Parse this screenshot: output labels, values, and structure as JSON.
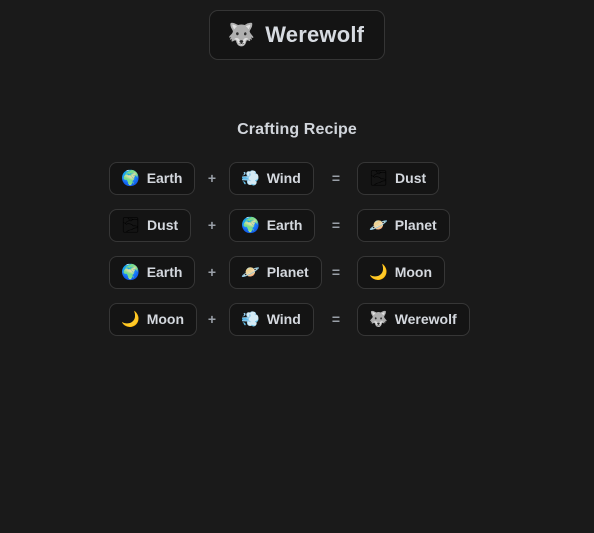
{
  "page": {
    "background_color": "#1a1a1a",
    "chip_background_color": "#141414",
    "chip_border_color": "#363636",
    "text_color": "#d4d8de"
  },
  "header": {
    "icon": "wolf-icon",
    "icon_glyph": "🐺",
    "title": "Werewolf"
  },
  "section": {
    "heading": "Crafting Recipe"
  },
  "operators": {
    "plus": "+",
    "equals": "="
  },
  "recipes": [
    {
      "input_a": {
        "icon": "earth-icon",
        "icon_glyph": "🌍",
        "label": "Earth"
      },
      "operator": "+",
      "input_b": {
        "icon": "wind-icon",
        "icon_glyph": "💨",
        "label": "Wind"
      },
      "equals": "=",
      "result": {
        "icon": "fog-icon",
        "icon_glyph": "🌫",
        "label": "Dust"
      }
    },
    {
      "input_a": {
        "icon": "fog-icon",
        "icon_glyph": "🌫",
        "label": "Dust"
      },
      "operator": "+",
      "input_b": {
        "icon": "earth-icon",
        "icon_glyph": "🌍",
        "label": "Earth"
      },
      "equals": "=",
      "result": {
        "icon": "planet-icon",
        "icon_glyph": "🪐",
        "label": "Planet"
      }
    },
    {
      "input_a": {
        "icon": "earth-icon",
        "icon_glyph": "🌍",
        "label": "Earth"
      },
      "operator": "+",
      "input_b": {
        "icon": "planet-icon",
        "icon_glyph": "🪐",
        "label": "Planet"
      },
      "equals": "=",
      "result": {
        "icon": "moon-icon",
        "icon_glyph": "🌙",
        "label": "Moon"
      }
    },
    {
      "input_a": {
        "icon": "moon-icon",
        "icon_glyph": "🌙",
        "label": "Moon"
      },
      "operator": "+",
      "input_b": {
        "icon": "wind-icon",
        "icon_glyph": "💨",
        "label": "Wind"
      },
      "equals": "=",
      "result": {
        "icon": "wolf-icon",
        "icon_glyph": "🐺",
        "label": "Werewolf"
      }
    }
  ]
}
